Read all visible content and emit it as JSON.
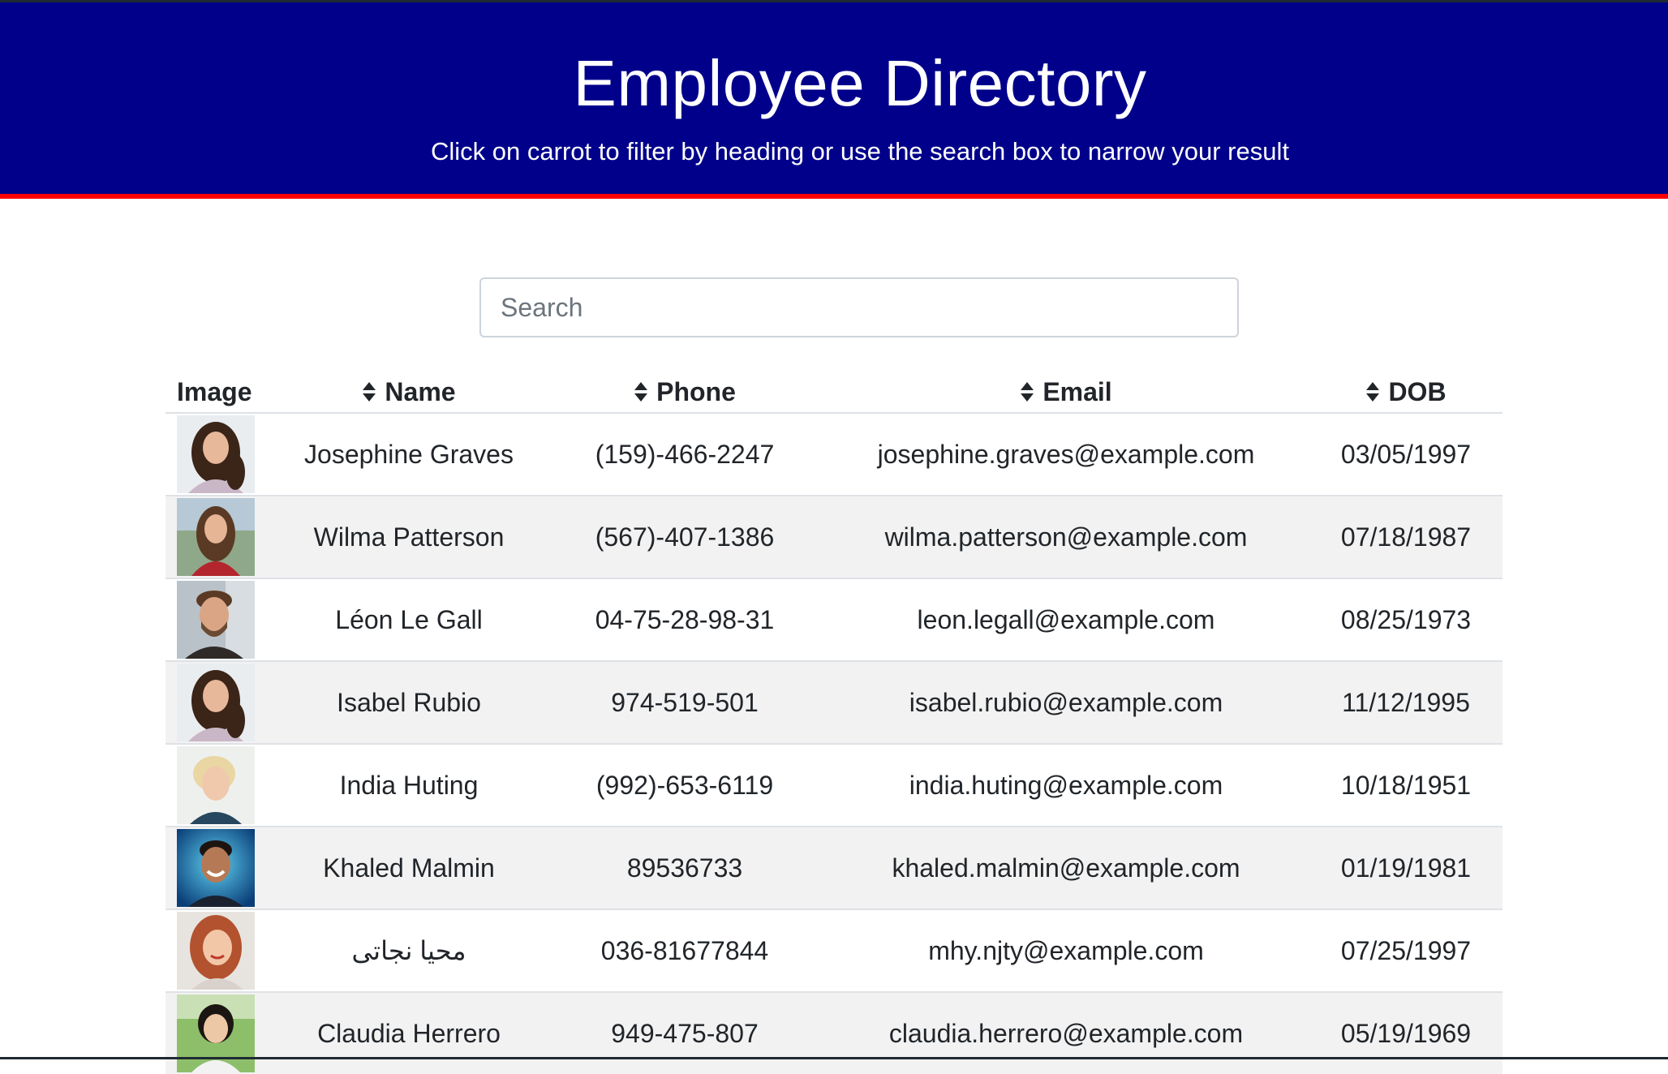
{
  "header": {
    "title": "Employee Directory",
    "subtitle": "Click on carrot to filter by heading or use the search box to narrow your result"
  },
  "colors": {
    "header_bg": "#00008b",
    "header_line": "#ff0000",
    "row_stripe": "#f2f2f2"
  },
  "search": {
    "placeholder": "Search",
    "value": ""
  },
  "table": {
    "columns": {
      "image": "Image",
      "name": "Name",
      "phone": "Phone",
      "email": "Email",
      "dob": "DOB"
    },
    "rows": [
      {
        "name": "Josephine Graves",
        "phone": "(159)-466-2247",
        "email": "josephine.graves@example.com",
        "dob": "03/05/1997",
        "avatar": "woman-curly-hair-photo"
      },
      {
        "name": "Wilma Patterson",
        "phone": "(567)-407-1386",
        "email": "wilma.patterson@example.com",
        "dob": "07/18/1987",
        "avatar": "woman-red-top-photo"
      },
      {
        "name": "Léon Le Gall",
        "phone": "04-75-28-98-31",
        "email": "leon.legall@example.com",
        "dob": "08/25/1973",
        "avatar": "man-beard-photo"
      },
      {
        "name": "Isabel Rubio",
        "phone": "974-519-501",
        "email": "isabel.rubio@example.com",
        "dob": "11/12/1995",
        "avatar": "woman-curly-hair-photo"
      },
      {
        "name": "India Huting",
        "phone": "(992)-653-6119",
        "email": "india.huting@example.com",
        "dob": "10/18/1951",
        "avatar": "woman-blonde-short-hair-photo"
      },
      {
        "name": "Khaled Malmin",
        "phone": "89536733",
        "email": "khaled.malmin@example.com",
        "dob": "01/19/1981",
        "avatar": "man-smiling-blue-background-photo"
      },
      {
        "name": "محیا نجاتی",
        "phone": "036-81677844",
        "email": "mhy.njty@example.com",
        "dob": "07/25/1997",
        "avatar": "woman-red-hair-photo"
      },
      {
        "name": "Claudia Herrero",
        "phone": "949-475-807",
        "email": "claudia.herrero@example.com",
        "dob": "05/19/1969",
        "avatar": "woman-dark-hair-outdoor-photo"
      }
    ]
  }
}
